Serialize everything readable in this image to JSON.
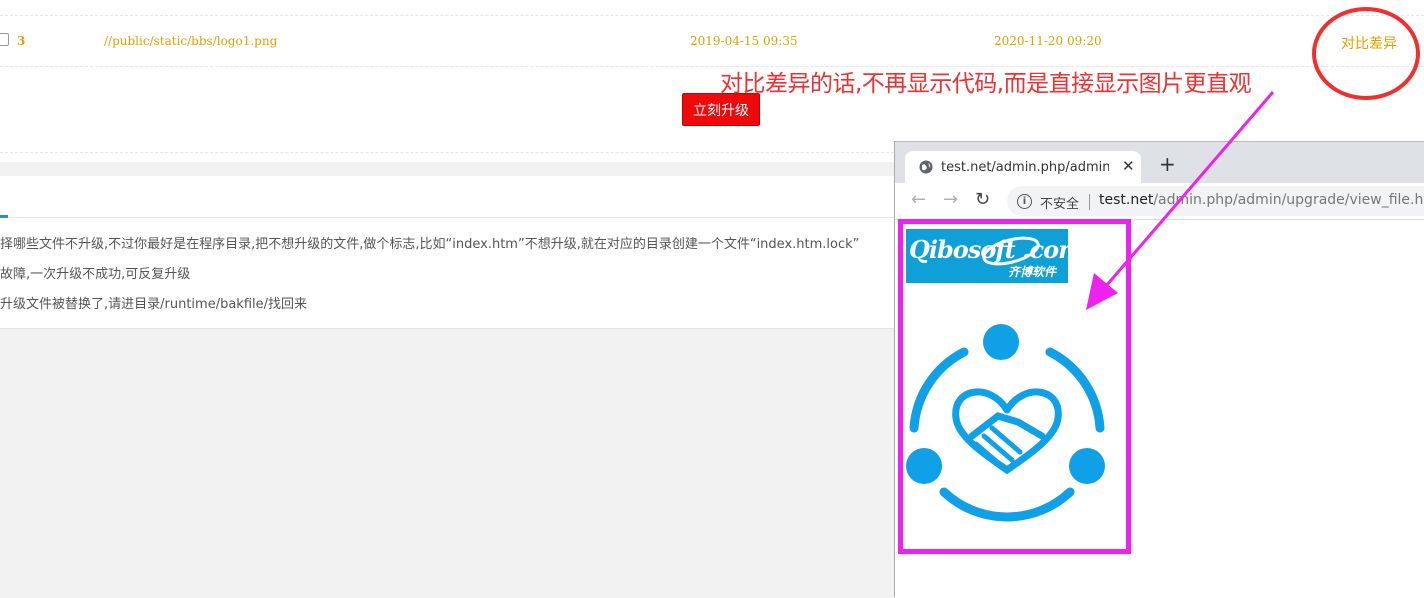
{
  "file_row": {
    "index": "3",
    "path": "//public/static/bbs/logo1.png",
    "old_date": "2019-04-15 09:35",
    "new_date": "2020-11-20 09:20",
    "compare_label": "对比差异"
  },
  "annotation": "对比差异的话,不再显示代码,而是直接显示图片更直观",
  "upgrade_button": "立刻升级",
  "notes": [
    "择哪些文件不升级,不过你最好是在程序目录,把不想升级的文件,做个标志,比如“index.htm”不想升级,就在对应的目录创建一个文件“index.htm.lock”",
    "故障,一次升级不成功,可反复升级",
    "升级文件被替换了,请进目录/runtime/bakfile/找回来"
  ],
  "browser": {
    "tab_title": "test.net/admin.php/admin/upgrade/view_file.html",
    "tab_close": "✕",
    "new_tab": "+",
    "insecure_label": "不安全",
    "url_domain": "test.net",
    "url_path": "/admin.php/admin/upgrade/view_file.html",
    "logo_text": "Qibosoft .com",
    "logo_subtext": "齐博软件"
  },
  "colors": {
    "accent_orange": "#e0a000",
    "annotation_red": "#f03030",
    "button_red": "#ee0a0a",
    "highlight_magenta": "#ee22ee",
    "icon_blue": "#0fa0e8"
  },
  "icons": [
    "checkbox-icon",
    "globe-icon",
    "back-arrow-icon",
    "forward-arrow-icon",
    "reload-icon",
    "info-icon",
    "handshake-heart-icon"
  ]
}
